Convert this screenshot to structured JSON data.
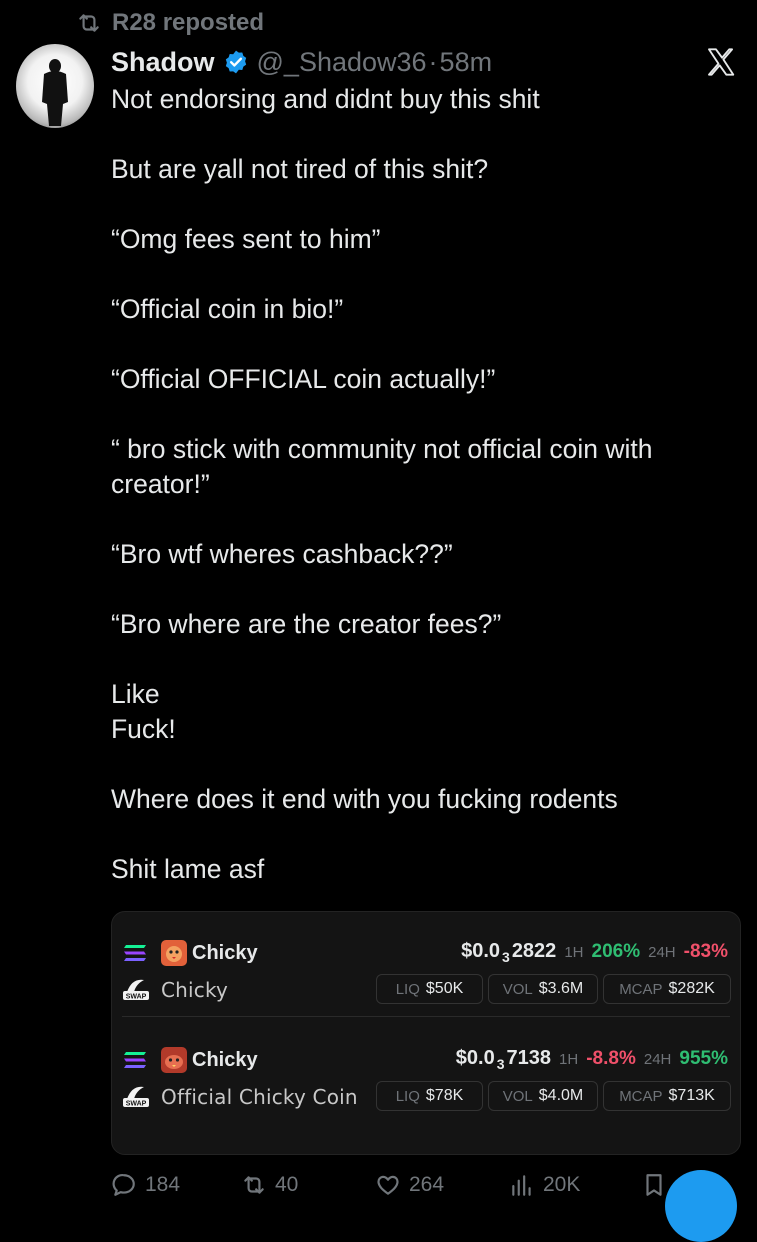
{
  "repost": {
    "label": "R28 reposted",
    "icon": "repost-icon"
  },
  "author": {
    "name": "Shadow",
    "handle": "@_Shadow36",
    "separator": "·",
    "time": "58m",
    "verified_color": "#1d9bf0"
  },
  "post": {
    "paragraphs": [
      "Not endorsing and didnt buy this shit",
      "But are yall not tired of this shit?",
      "“Omg fees sent to him”",
      "“Official coin in bio!”",
      "“Official OFFICIAL coin actually!”",
      "“ bro stick with community not official coin with creator!”",
      "“Bro wtf wheres cashback??”",
      "“Bro where are the creator fees?”",
      "Like\nFuck!",
      "Where does it end with you fucking rodents",
      "Shit lame asf"
    ]
  },
  "card": {
    "rows": [
      {
        "symbol": "Chicky",
        "name": "Chicky",
        "price_prefix": "$0.0",
        "price_zeros": "3",
        "price_digits": "2822",
        "h1_label": "1H",
        "h1_value": "206%",
        "h1_dir": "up",
        "h24_label": "24H",
        "h24_value": "-83%",
        "h24_dir": "down",
        "liq_label": "LIQ",
        "liq_value": "$50K",
        "vol_label": "VOL",
        "vol_value": "$3.6M",
        "mcap_label": "MCAP",
        "mcap_value": "$282K",
        "swap_label": "SWAP"
      },
      {
        "symbol": "Chicky",
        "name": "Official Chicky Coin",
        "price_prefix": "$0.0",
        "price_zeros": "3",
        "price_digits": "7138",
        "h1_label": "1H",
        "h1_value": "-8.8%",
        "h1_dir": "down",
        "h24_label": "24H",
        "h24_value": "955%",
        "h24_dir": "up",
        "liq_label": "LIQ",
        "liq_value": "$78K",
        "vol_label": "VOL",
        "vol_value": "$4.0M",
        "mcap_label": "MCAP",
        "mcap_value": "$713K",
        "swap_label": "SWAP"
      }
    ]
  },
  "actions": {
    "replies": "184",
    "reposts": "40",
    "likes": "264",
    "views": "20K"
  },
  "colors": {
    "accent": "#1d9bf0",
    "up": "#2fbd72",
    "down": "#f0506a",
    "background": "#000000"
  }
}
